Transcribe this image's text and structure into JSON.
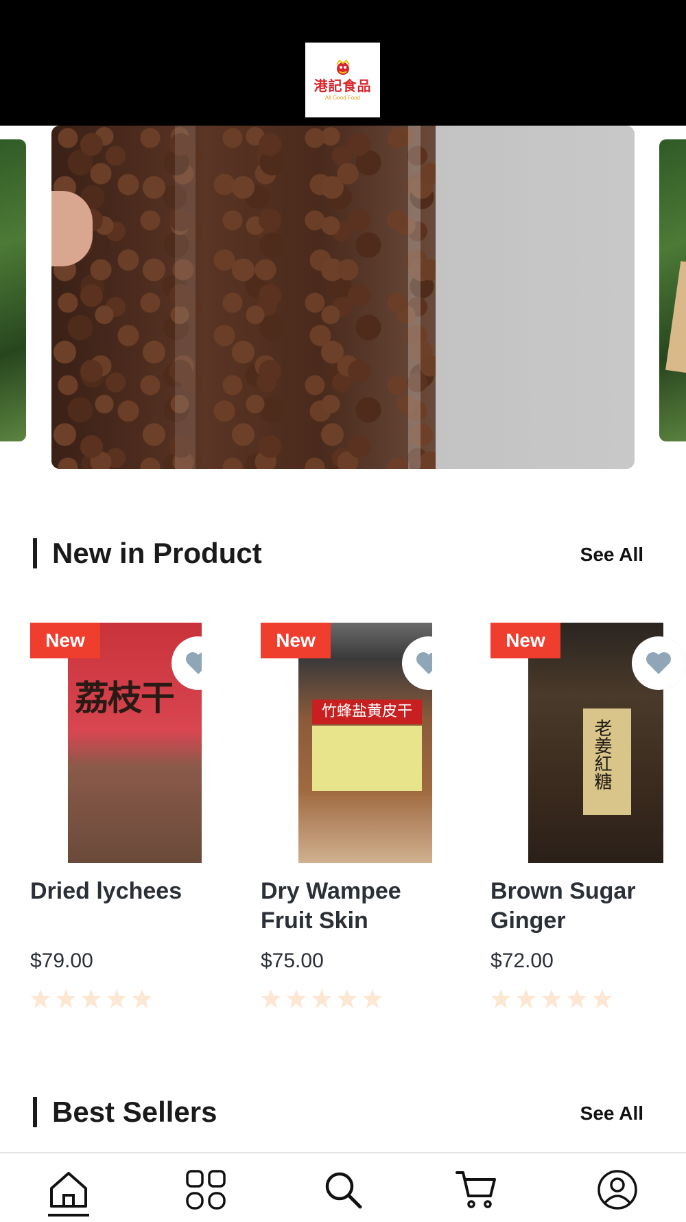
{
  "header": {
    "logo_cn": "港記食品",
    "logo_en": "All Good Food"
  },
  "banner": {
    "current_slide": 2
  },
  "new_in_product": {
    "title": "New in Product",
    "see_all": "See All",
    "items": [
      {
        "badge": "New",
        "name": "Dried lychees",
        "price": "$79.00",
        "rating": 0,
        "photo_label": "荔枝干"
      },
      {
        "badge": "New",
        "name": "Dry Wampee Fruit Skin",
        "price": "$75.00",
        "rating": 0,
        "photo_label": "竹蜂盐黄皮干"
      },
      {
        "badge": "New",
        "name": "Brown Sugar Ginger",
        "price": "$72.00",
        "rating": 0,
        "photo_label": "老姜紅糖"
      }
    ]
  },
  "best_sellers": {
    "title": "Best Sellers",
    "see_all": "See All"
  },
  "bottom_nav": {
    "items": [
      "home-icon",
      "categories-icon",
      "search-icon",
      "cart-icon",
      "account-icon"
    ],
    "active": "home-icon"
  },
  "colors": {
    "header_bg": "#000000",
    "badge": "#ef3d2e",
    "heart": "#8fa6b8",
    "star_empty": "#fde6d2",
    "text": "#2b2f36"
  }
}
